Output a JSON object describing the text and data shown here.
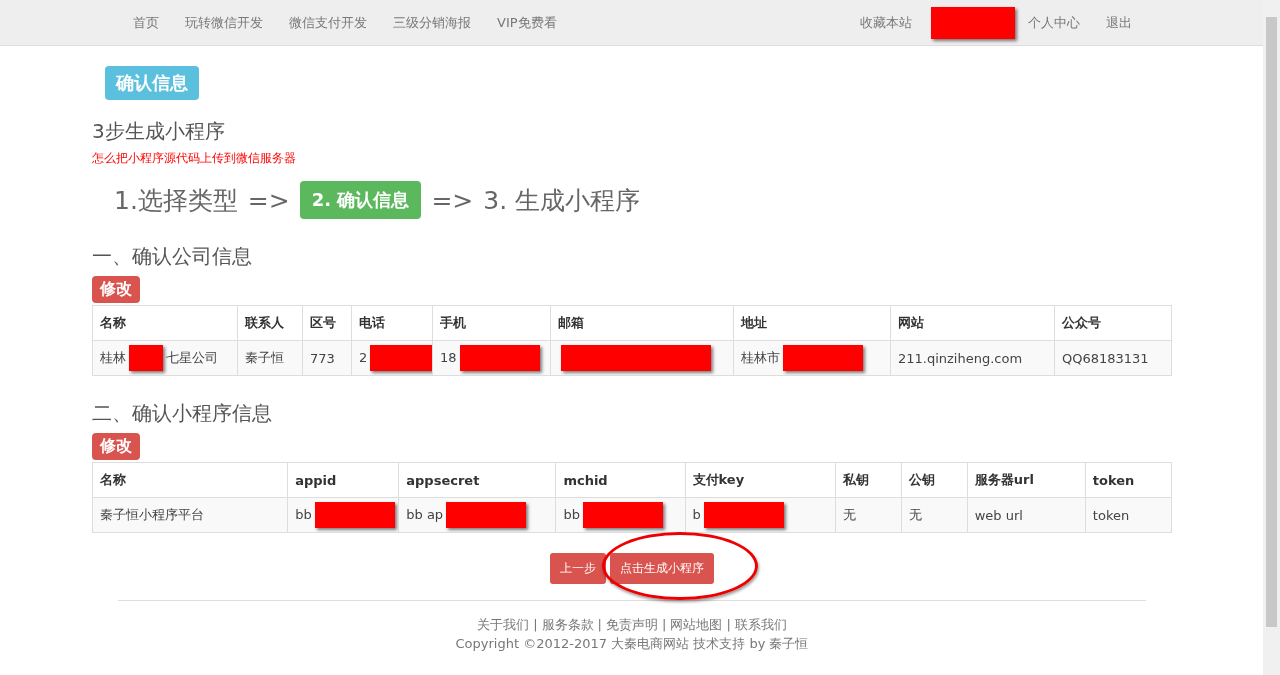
{
  "nav": {
    "left": [
      {
        "label": "首页"
      },
      {
        "label": "玩转微信开发"
      },
      {
        "label": "微信支付开发"
      },
      {
        "label": "三级分销海报"
      },
      {
        "label": "VIP免费看"
      }
    ],
    "right": [
      {
        "label": "收藏本站"
      },
      {
        "redacted": true
      },
      {
        "label": "个人中心"
      },
      {
        "label": "退出"
      }
    ]
  },
  "page_badge": "确认信息",
  "title": "3步生成小程序",
  "help_link": "怎么把小程序源代码上传到微信服务器",
  "steps": [
    {
      "label": "1.选择类型",
      "kind": "step",
      "selected": false
    },
    {
      "label": "=>",
      "kind": "arrow"
    },
    {
      "label": "2. 确认信息",
      "kind": "step",
      "selected": true
    },
    {
      "label": "=>",
      "kind": "arrow"
    },
    {
      "label": "3. 生成小程序",
      "kind": "step",
      "selected": false
    }
  ],
  "sections": [
    {
      "heading": "一、确认公司信息",
      "edit_button": "修改",
      "columns": [
        "名称",
        "联系人",
        "区号",
        "电话",
        "手机",
        "邮箱",
        "地址",
        "网站",
        "公众号"
      ],
      "rows": [
        [
          {
            "text": "桂林",
            "redacted": true,
            "after": "七星公司"
          },
          {
            "text": "秦子恒"
          },
          {
            "text": "773"
          },
          {
            "text": "2",
            "redacted": true
          },
          {
            "text": "18",
            "redacted": true
          },
          {
            "redacted": true
          },
          {
            "text": "桂林市",
            "redacted": true
          },
          {
            "text": "211.qinziheng.com"
          },
          {
            "text": "QQ68183131"
          }
        ]
      ]
    },
    {
      "heading": "二、确认小程序信息",
      "edit_button": "修改",
      "columns": [
        "名称",
        "appid",
        "appsecret",
        "mchid",
        "支付key",
        "私钥",
        "公钥",
        "服务器url",
        "token"
      ],
      "rows": [
        [
          {
            "text": "秦子恒小程序平台"
          },
          {
            "text": "bb",
            "redacted": true
          },
          {
            "text": "bb ap",
            "redacted": true
          },
          {
            "text": "bb",
            "redacted": true
          },
          {
            "text": "b",
            "redacted": true
          },
          {
            "text": "无"
          },
          {
            "text": "无"
          },
          {
            "text": "web url"
          },
          {
            "text": "token"
          }
        ]
      ]
    }
  ],
  "actions": [
    {
      "label": "上一步",
      "circled": false
    },
    {
      "label": "点击生成小程序",
      "circled": true
    }
  ],
  "footer": {
    "separator": "|",
    "links": [
      "关于我们",
      "服务条款",
      "免责声明",
      "网站地图",
      "联系我们"
    ],
    "copyright": "Copyright ©2012-2017 大秦电商网站 技术支持 by 秦子恒"
  }
}
